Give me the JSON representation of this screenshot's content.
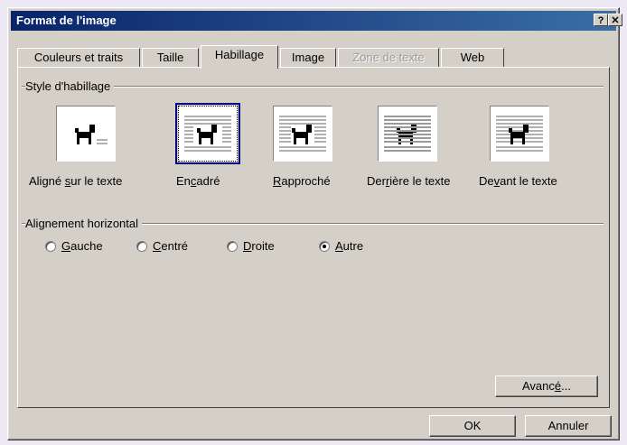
{
  "window": {
    "title": "Format de l'image",
    "help_label": "?",
    "close_label": "✕"
  },
  "tabs": [
    {
      "label": "Couleurs et traits",
      "state": "normal"
    },
    {
      "label": "Taille",
      "state": "normal"
    },
    {
      "label": "Habillage",
      "state": "active"
    },
    {
      "label": "Image",
      "state": "normal"
    },
    {
      "label": "Zone de texte",
      "state": "disabled"
    },
    {
      "label": "Web",
      "state": "normal"
    }
  ],
  "wrap_style": {
    "group_label": "Style d'habillage",
    "options": [
      {
        "label_pre": "Aligné ",
        "label_key": "s",
        "label_post": "ur le texte",
        "icon": "dog-inline-icon",
        "selected": false
      },
      {
        "label_pre": "En",
        "label_key": "c",
        "label_post": "adré",
        "icon": "dog-square-icon",
        "selected": true
      },
      {
        "label_pre": "",
        "label_key": "R",
        "label_post": "approché",
        "icon": "dog-tight-icon",
        "selected": false
      },
      {
        "label_pre": "Der",
        "label_key": "r",
        "label_post": "ière le texte",
        "icon": "dog-behind-text-icon",
        "selected": false
      },
      {
        "label_pre": "De",
        "label_key": "v",
        "label_post": "ant le texte",
        "icon": "dog-in-front-icon",
        "selected": false
      }
    ]
  },
  "horizontal_alignment": {
    "group_label": "Alignement horizontal",
    "options": [
      {
        "label_pre": "",
        "label_key": "G",
        "label_post": "auche",
        "checked": false
      },
      {
        "label_pre": "",
        "label_key": "C",
        "label_post": "entré",
        "checked": false
      },
      {
        "label_pre": "",
        "label_key": "D",
        "label_post": "roite",
        "checked": false
      },
      {
        "label_pre": "",
        "label_key": "A",
        "label_post": "utre",
        "checked": true
      }
    ]
  },
  "buttons": {
    "advanced_pre": "Avanc",
    "advanced_key": "é",
    "advanced_post": "...",
    "ok": "OK",
    "cancel": "Annuler"
  }
}
